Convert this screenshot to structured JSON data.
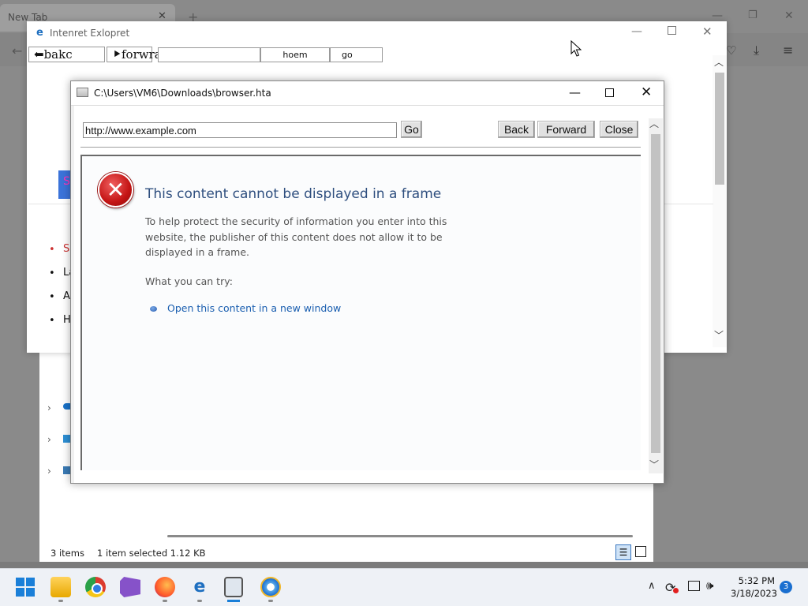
{
  "background_browser": {
    "tab_title": "New Tab",
    "tab_close": "✕",
    "new_tab": "+",
    "back": "←",
    "window_min": "—",
    "window_restore": "❐",
    "window_close": "✕"
  },
  "fake_ie": {
    "logo": "e",
    "title": "Intenret Exlopret",
    "back_label": "⬅bakc",
    "forward_label": "⯈forwrad",
    "home_label": "hoem",
    "go_label": "go",
    "url_value": "",
    "blue_tab_char": "S",
    "list_items": [
      "S",
      "La",
      "A",
      "H"
    ],
    "min": "—",
    "close": "✕"
  },
  "hta": {
    "title": "C:\\Users\\VM6\\Downloads\\browser.hta",
    "url_value": "http://www.example.com",
    "go_label": "Go",
    "back_label": "Back",
    "forward_label": "Forward",
    "close_label": "Close",
    "min": "—",
    "close": "✕"
  },
  "error_page": {
    "icon": "✕",
    "title": "This content cannot be displayed in a frame",
    "description": "To help protect the security of information you enter into this website, the publisher of this content does not allow it to be displayed in a frame.",
    "try_heading": "What you can try:",
    "link_text": "Open this content in a new window"
  },
  "explorer": {
    "items_count": "3 items",
    "selected": "1 item selected  1.12 KB"
  },
  "taskbar": {
    "time": "5:32 PM",
    "date": "3/18/2023",
    "notification_count": "3",
    "ie_icon": "e",
    "chevron": "∧",
    "volume": "🕪",
    "update": "⟳"
  },
  "icons": {
    "start": "windows-logo-icon",
    "explorer": "folder-icon",
    "chrome": "chrome-icon",
    "visual_studio": "visual-studio-icon",
    "firefox": "firefox-icon",
    "ie": "internet-explorer-icon",
    "hta": "hta-app-icon",
    "ie_color": "ie-color-icon"
  },
  "colors": {
    "accent": "#1a7fd8",
    "error_title": "#2f4f7f",
    "link": "#1b5fb0",
    "error_red": "#c41414"
  }
}
